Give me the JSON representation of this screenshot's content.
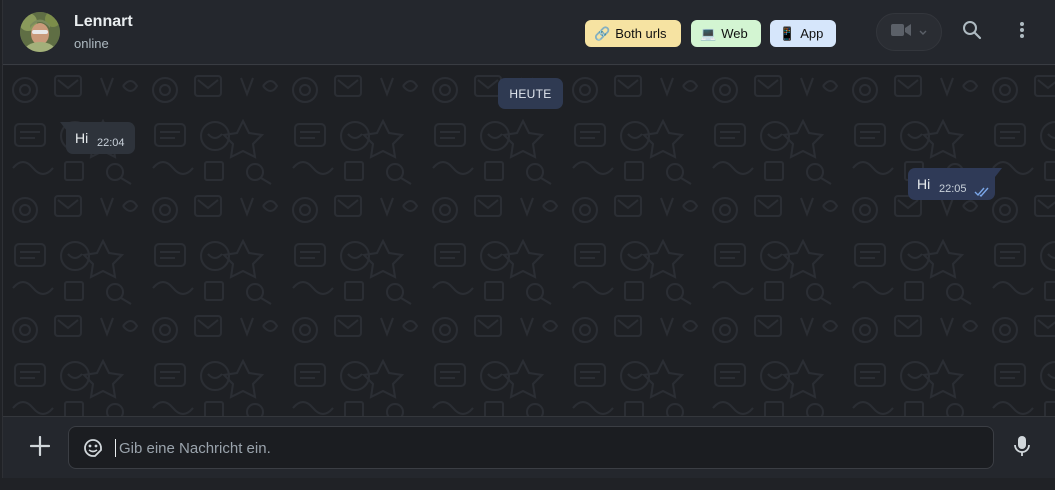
{
  "header": {
    "contact_name": "Lennart",
    "status": "online",
    "chips": {
      "both": {
        "glyph": "🔗",
        "label": "Both urls"
      },
      "web": {
        "glyph": "💻",
        "label": "Web"
      },
      "app": {
        "glyph": "📱",
        "label": "App"
      }
    }
  },
  "conversation": {
    "date_separator": "HEUTE",
    "messages": [
      {
        "direction": "incoming",
        "text": "Hi",
        "time": "22:04"
      },
      {
        "direction": "outgoing",
        "text": "Hi",
        "time": "22:05",
        "status": "read"
      }
    ]
  },
  "composer": {
    "placeholder": "Gib eine Nachricht ein."
  },
  "colors": {
    "incoming_bubble": "#2e333b",
    "outgoing_bubble": "#2f3a57",
    "read_ticks": "#7aa6e8"
  }
}
